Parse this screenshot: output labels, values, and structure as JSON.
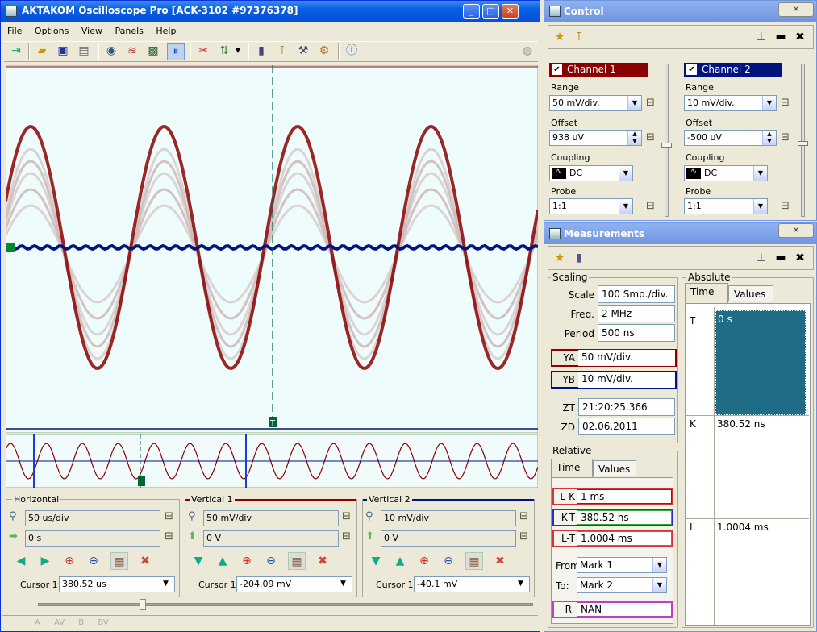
{
  "main": {
    "title": "AKTAKOM Oscilloscope Pro [ACK-3102 #97376378]",
    "menu": [
      "File",
      "Options",
      "View",
      "Panels",
      "Help"
    ],
    "horizontal": {
      "title": "Horizontal",
      "timebase": "50 us/div",
      "position": "0 s",
      "cursor_label": "Cursor 1:",
      "cursor_value": "380.52 us"
    },
    "vertical1": {
      "title": "Vertical 1",
      "range": "50 mV/div",
      "offset": "0 V",
      "cursor_label": "Cursor 1:",
      "cursor_value": "-204.09 mV"
    },
    "vertical2": {
      "title": "Vertical 2",
      "range": "10 mV/div",
      "offset": "0 V",
      "cursor_label": "Cursor 1:",
      "cursor_value": "-40.1 mV"
    },
    "status": [
      "A",
      "AV",
      "B",
      "BV"
    ],
    "markers": {
      "trigger": "T"
    }
  },
  "control": {
    "title": "Control",
    "ch1": {
      "name": "Channel 1",
      "range_label": "Range",
      "range": "50 mV/div.",
      "offset_label": "Offset",
      "offset": "938 uV",
      "coupling_label": "Coupling",
      "coupling": "DC",
      "probe_label": "Probe",
      "probe": "1:1"
    },
    "ch2": {
      "name": "Channel 2",
      "range_label": "Range",
      "range": "10 mV/div.",
      "offset_label": "Offset",
      "offset": "-500 uV",
      "coupling_label": "Coupling",
      "coupling": "DC",
      "probe_label": "Probe",
      "probe": "1:1"
    }
  },
  "meas": {
    "title": "Measurements",
    "scaling": {
      "title": "Scaling",
      "scale_l": "Scale",
      "scale": "100 Smp./div.",
      "freq_l": "Freq.",
      "freq": "2 MHz",
      "period_l": "Period",
      "period": "500 ns",
      "ya_l": "YA",
      "ya": "50 mV/div.",
      "yb_l": "YB",
      "yb": "10 mV/div.",
      "zt_l": "ZT",
      "zt": "21:20:25.366",
      "zd_l": "ZD",
      "zd": "02.06.2011"
    },
    "relative": {
      "title": "Relative",
      "tab_time": "Time",
      "tab_values": "Values",
      "lk_l": "L-K",
      "lk": "1 ms",
      "kt_l": "K-T",
      "kt": "380.52 ns",
      "lt_l": "L-T",
      "lt": "1.0004 ms",
      "from_l": "From",
      "from": "Mark 1",
      "to_l": "To:",
      "to": "Mark 2",
      "r_l": "R",
      "r": "NAN"
    },
    "absolute": {
      "title": "Absolute",
      "tab_time": "Time",
      "tab_values": "Values",
      "t_l": "T",
      "t": "0 s",
      "k_l": "K",
      "k": "380.52 ns",
      "l_l": "L",
      "l": "1.0004 ms"
    }
  },
  "colors": {
    "ch1": "#8b0000",
    "ch2": "#00137f",
    "plot_bg": "#eefcfc"
  }
}
